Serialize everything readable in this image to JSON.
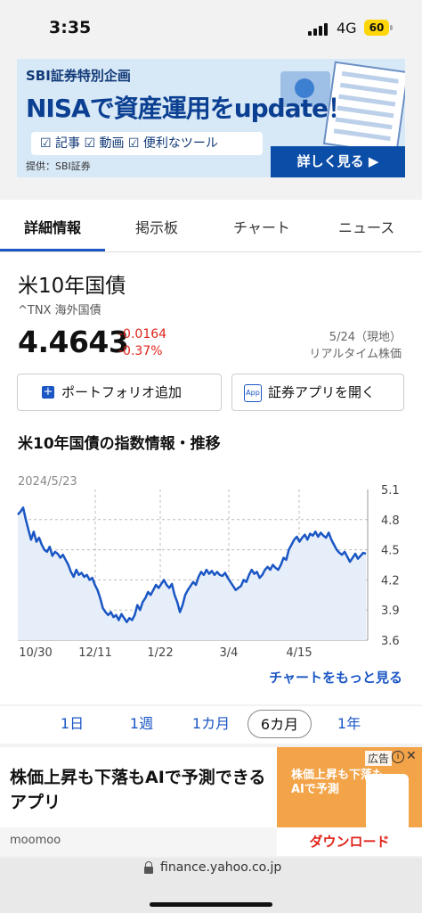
{
  "status": {
    "time": "3:35",
    "network": "4G",
    "battery": "60"
  },
  "banner": {
    "head": "SBI証券特別企画",
    "main": "NISAで資産運用をupdate！",
    "pills": "☑ 記事 ☑ 動画 ☑ 便利なツール",
    "provider": "提供：SBI証券",
    "cta": "詳しく見る ▶"
  },
  "tabs": [
    "詳細情報",
    "掲示板",
    "チャート",
    "ニュース"
  ],
  "quote": {
    "name": "米10年国債",
    "ticker": "^TNX 海外国債",
    "price": "4.4643",
    "change": "-0.0164",
    "change_pct": "-0.37%",
    "date": "5/24（現地）",
    "realtime": "リアルタイム株価",
    "colors": {
      "down": "#e0241b",
      "link": "#1a56c4"
    }
  },
  "buttons": {
    "portfolio": "ポートフォリオ追加",
    "app": "証券アプリを開く",
    "app_icon": "App"
  },
  "section_title": "米10年国債の指数情報・推移",
  "chart_data": {
    "type": "line",
    "date_label": "2024/5/23",
    "x_ticks": [
      "10/30",
      "12/11",
      "1/22",
      "3/4",
      "4/15"
    ],
    "y_ticks": [
      "5.1",
      "4.8",
      "4.5",
      "4.2",
      "3.9",
      "3.6"
    ],
    "ylim": [
      3.6,
      5.1
    ],
    "series": [
      {
        "values": [
          4.85,
          4.88,
          4.92,
          4.8,
          4.7,
          4.6,
          4.68,
          4.58,
          4.62,
          4.55,
          4.5,
          4.48,
          4.53,
          4.44,
          4.48,
          4.46,
          4.42,
          4.45,
          4.4,
          4.35,
          4.28,
          4.23,
          4.3,
          4.25,
          4.27,
          4.23,
          4.25,
          4.2,
          4.22,
          4.15,
          4.1,
          4.02,
          3.92,
          3.88,
          3.85,
          3.88,
          3.83,
          3.85,
          3.8,
          3.86,
          3.82,
          3.78,
          3.82,
          3.8,
          3.85,
          3.95,
          3.9,
          3.98,
          4.02,
          4.08,
          4.05,
          4.1,
          4.15,
          4.12,
          4.16,
          4.2,
          4.15,
          4.12,
          4.16,
          4.05,
          3.98,
          3.88,
          3.95,
          4.05,
          4.1,
          4.14,
          4.18,
          4.15,
          4.23,
          4.28,
          4.25,
          4.3,
          4.26,
          4.29,
          4.25,
          4.28,
          4.25,
          4.24,
          4.27,
          4.22,
          4.18,
          4.14,
          4.1,
          4.12,
          4.14,
          4.2,
          4.18,
          4.25,
          4.3,
          4.26,
          4.28,
          4.22,
          4.25,
          4.3,
          4.33,
          4.3,
          4.35,
          4.32,
          4.3,
          4.35,
          4.42,
          4.4,
          4.5,
          4.55,
          4.6,
          4.63,
          4.58,
          4.62,
          4.65,
          4.6,
          4.66,
          4.64,
          4.68,
          4.63,
          4.67,
          4.64,
          4.62,
          4.67,
          4.6,
          4.55,
          4.5,
          4.47,
          4.45,
          4.48,
          4.43,
          4.38,
          4.42,
          4.46,
          4.41,
          4.44,
          4.47,
          4.46
        ]
      }
    ]
  },
  "more_link": "チャートをもっと見る",
  "ranges": [
    "1日",
    "1週",
    "1カ月",
    "6カ月",
    "1年"
  ],
  "ad": {
    "text": "株価上昇も下落もAIで予測できるアプリ",
    "brand": "moomoo",
    "img_line1": "株価上昇も下落も",
    "img_line2": "AIで予測",
    "download": "ダウンロード",
    "label": "広告"
  },
  "url": "finance.yahoo.co.jp"
}
